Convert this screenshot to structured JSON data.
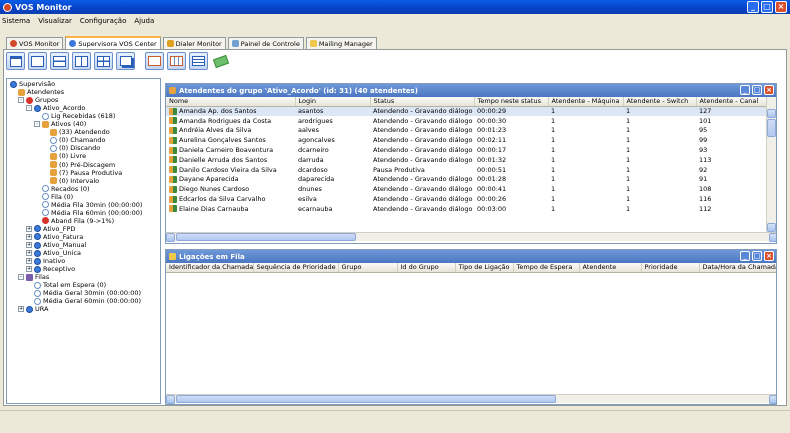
{
  "window": {
    "title": "VOS Monitor"
  },
  "menu": [
    "Sistema",
    "Visualizar",
    "Configuração",
    "Ajuda"
  ],
  "tabs": [
    {
      "label": "VOS Monitor",
      "color": "#d24a2a"
    },
    {
      "label": "Supervisora VOS Center",
      "color": "#3b78d8",
      "active": true
    },
    {
      "label": "Dialer Monitor",
      "color": "#e0a020"
    },
    {
      "label": "Painel de Controle",
      "color": "#6fa0d0"
    },
    {
      "label": "Mailing Manager",
      "color": "#f1c74c"
    }
  ],
  "tree": [
    {
      "label": "Supervisão",
      "icon": "circle-icon",
      "level": 0
    },
    {
      "label": "Atendentes",
      "icon": "agents-icon",
      "level": 1
    },
    {
      "label": "Grupos",
      "icon": "groups-icon",
      "level": 1,
      "exp": "-"
    },
    {
      "label": "Ativo_Acordo",
      "icon": "group-icon",
      "level": 2,
      "exp": "-"
    },
    {
      "label": "Lig Recebidas (618)",
      "icon": "phone-icon",
      "level": 4
    },
    {
      "label": "Ativos (40)",
      "icon": "agents-icon",
      "level": 3,
      "exp": "-"
    },
    {
      "label": "(33) Atendendo",
      "icon": "agent-icon",
      "level": 5
    },
    {
      "label": "(0) Chamando",
      "icon": "phone-icon",
      "level": 5
    },
    {
      "label": "(0) Discando",
      "icon": "phone-icon",
      "level": 5
    },
    {
      "label": "(0) Livre",
      "icon": "agent-icon",
      "level": 5
    },
    {
      "label": "(0) Pré-Discagem",
      "icon": "agent-icon",
      "level": 5
    },
    {
      "label": "(7) Pausa Produtiva",
      "icon": "agent-icon",
      "level": 5
    },
    {
      "label": "(0) Intervalo",
      "icon": "agent-icon",
      "level": 5
    },
    {
      "label": "Recados (0)",
      "icon": "message-icon",
      "level": 4
    },
    {
      "label": "Fila (0)",
      "icon": "queue-icon",
      "level": 4
    },
    {
      "label": "Média Fila 30min (00:00:00)",
      "icon": "clock-icon",
      "level": 4
    },
    {
      "label": "Média Fila 60min (00:00:00)",
      "icon": "clock-icon",
      "level": 4
    },
    {
      "label": "Aband Fila (9->1%)",
      "icon": "abandon-icon",
      "level": 4
    },
    {
      "label": "Ativo_FPD",
      "icon": "group-icon",
      "level": 2,
      "exp": "+"
    },
    {
      "label": "Ativo_Fatura",
      "icon": "group-icon",
      "level": 2,
      "exp": "+"
    },
    {
      "label": "Ativo_Manual",
      "icon": "group-icon",
      "level": 2,
      "exp": "+"
    },
    {
      "label": "Ativo_Unica",
      "icon": "group-icon",
      "level": 2,
      "exp": "+"
    },
    {
      "label": "Inativo",
      "icon": "group-icon",
      "level": 2,
      "exp": "+"
    },
    {
      "label": "Receptivo",
      "icon": "group-icon",
      "level": 2,
      "exp": "+"
    },
    {
      "label": "Filas",
      "icon": "queues-icon",
      "level": 1,
      "exp": "-"
    },
    {
      "label": "Total em Espera (0)",
      "icon": "clock-icon",
      "level": 3
    },
    {
      "label": "Média Geral 30min (00:00:00)",
      "icon": "clock-icon",
      "level": 3
    },
    {
      "label": "Média Geral 60min (00:00:00)",
      "icon": "clock-icon",
      "level": 3
    },
    {
      "label": "URA",
      "icon": "ura-icon",
      "level": 1,
      "exp": "+"
    }
  ],
  "agents_panel": {
    "title": "Atendentes do grupo 'Ativo_Acordo' (id: 31) (40 atendentes)",
    "columns": [
      "Nome",
      "Login",
      "Status",
      "Tempo neste status",
      "Atendente - Máquina",
      "Atendente - Switch",
      "Atendente - Canal"
    ],
    "rows": [
      [
        "Amanda Ap. dos Santos",
        "asantos",
        "Atendendo - Gravando diálogo",
        "00:00:29",
        "1",
        "1",
        "127"
      ],
      [
        "Amanda Rodrigues da Costa",
        "arodrigues",
        "Atendendo - Gravando diálogo",
        "00:00:30",
        "1",
        "1",
        "101"
      ],
      [
        "Andréia Alves da Silva",
        "aalves",
        "Atendendo - Gravando diálogo",
        "00:01:23",
        "1",
        "1",
        "95"
      ],
      [
        "Aurelina Gonçalves Santos",
        "agoncalves",
        "Atendendo - Gravando diálogo",
        "00:02:11",
        "1",
        "1",
        "99"
      ],
      [
        "Daniela Carneiro Boaventura",
        "dcarneiro",
        "Atendendo - Gravando diálogo",
        "00:00:17",
        "1",
        "1",
        "93"
      ],
      [
        "Danielle Arruda dos Santos",
        "darruda",
        "Atendendo - Gravando diálogo",
        "00:01:32",
        "1",
        "1",
        "113"
      ],
      [
        "Danilo Cardoso Vieira da Silva",
        "dcardoso",
        "Pausa Produtiva",
        "00:00:51",
        "1",
        "1",
        "92"
      ],
      [
        "Dayane Aparecida",
        "daparecida",
        "Atendendo - Gravando diálogo",
        "00:01:28",
        "1",
        "1",
        "91"
      ],
      [
        "Diego Nunes Cardoso",
        "dnunes",
        "Atendendo - Gravando diálogo",
        "00:00:41",
        "1",
        "1",
        "108"
      ],
      [
        "Edcarlos da Silva Carvalho",
        "esilva",
        "Atendendo - Gravando diálogo",
        "00:00:26",
        "1",
        "1",
        "116"
      ],
      [
        "Elaine Dias Carnauba",
        "ecarnauba",
        "Atendendo - Gravando diálogo",
        "00:03:00",
        "1",
        "1",
        "112"
      ]
    ]
  },
  "queue_panel": {
    "title": "Ligações em Fila",
    "columns": [
      "Identificador da Chamada",
      "Sequência de Prioridade",
      "Grupo",
      "Id do Grupo",
      "Tipo de Ligação",
      "Tempo de Espera",
      "Atendente",
      "Prioridade",
      "Data/Hora da Chamada"
    ]
  }
}
